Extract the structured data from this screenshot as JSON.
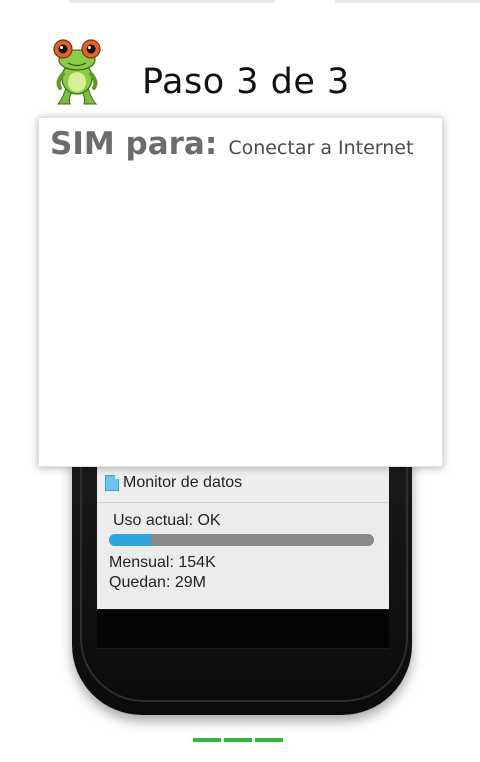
{
  "header": {
    "step_title": "Paso 3 de 3"
  },
  "card": {
    "sim_label": "SIM para:",
    "purpose": "Conectar a Internet"
  },
  "phone_widget": {
    "title": "Monitor de datos",
    "usage_status": "Uso actual: OK",
    "usage_fraction": 0.16,
    "monthly": "Mensual: 154K",
    "remaining": "Quedan: 29M"
  },
  "pager": {
    "total_steps": 3,
    "current_step": 3,
    "active_color": "#2db83d"
  },
  "icons": {
    "logo": "frog-mascot-icon",
    "widget": "document-icon"
  }
}
